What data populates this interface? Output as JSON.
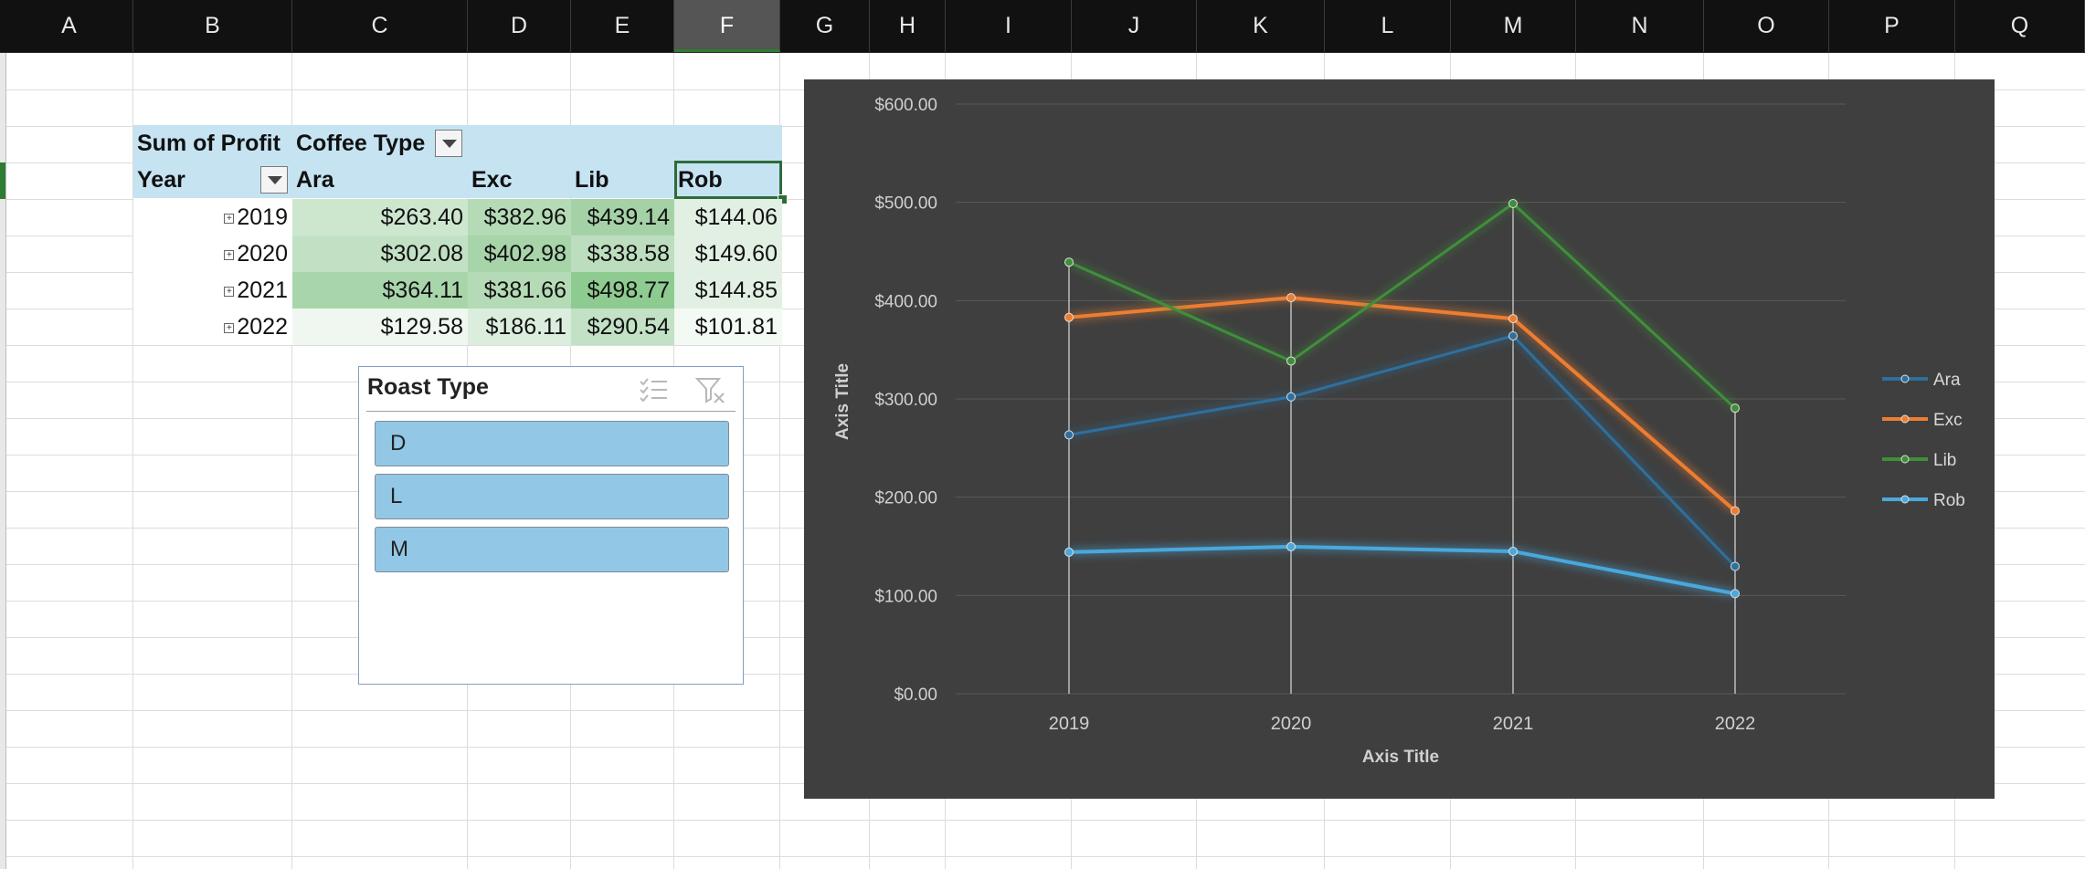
{
  "columns": [
    "A",
    "B",
    "C",
    "D",
    "E",
    "F",
    "G",
    "H",
    "I",
    "J",
    "K",
    "L",
    "M",
    "N",
    "O",
    "P",
    "Q"
  ],
  "active_column": "F",
  "pivot": {
    "corner_label": "Sum of Profit",
    "col_field_label": "Coffee Type",
    "row_field_label": "Year",
    "col_headers": [
      "Ara",
      "Exc",
      "Lib",
      "Rob"
    ],
    "rows": [
      {
        "year": "2019",
        "values": [
          "$263.40",
          "$382.96",
          "$439.14",
          "$144.06"
        ]
      },
      {
        "year": "2020",
        "values": [
          "$302.08",
          "$402.98",
          "$338.58",
          "$149.60"
        ]
      },
      {
        "year": "2021",
        "values": [
          "$364.11",
          "$381.66",
          "$498.77",
          "$144.85"
        ]
      },
      {
        "year": "2022",
        "values": [
          "$129.58",
          "$186.11",
          "$290.54",
          "$101.81"
        ]
      }
    ],
    "heat_colors": [
      [
        "#cde7cf",
        "#b4dbb6",
        "#a4d2a6",
        "#e2f0e3"
      ],
      [
        "#c2e1c4",
        "#a8d4aa",
        "#bcdebe",
        "#e2f0e3"
      ],
      [
        "#a9d5ab",
        "#b4dbb6",
        "#8ecb91",
        "#e2f0e3"
      ],
      [
        "#eff7f0",
        "#dbeddc",
        "#c3e1c5",
        "#f3f9f3"
      ]
    ]
  },
  "slicer": {
    "title": "Roast Type",
    "items": [
      "D",
      "L",
      "M"
    ],
    "multiselect_icon": "multi-select-icon",
    "clear_icon": "clear-filter-icon"
  },
  "chart_data": {
    "type": "line",
    "x": [
      "2019",
      "2020",
      "2021",
      "2022"
    ],
    "series": [
      {
        "name": "Ara",
        "values": [
          263.4,
          302.08,
          364.11,
          129.58
        ],
        "color": "#2e6f9e"
      },
      {
        "name": "Exc",
        "values": [
          382.96,
          402.98,
          381.66,
          186.11
        ],
        "color": "#ed7d31"
      },
      {
        "name": "Lib",
        "values": [
          439.14,
          338.58,
          498.77,
          290.54
        ],
        "color": "#3f8f3a"
      },
      {
        "name": "Rob",
        "values": [
          144.06,
          149.6,
          144.85,
          101.81
        ],
        "color": "#4aa8dc"
      }
    ],
    "y_ticks": [
      "$0.00",
      "$100.00",
      "$200.00",
      "$300.00",
      "$400.00",
      "$500.00",
      "$600.00"
    ],
    "ylim": [
      0,
      600
    ],
    "xlabel": "Axis Title",
    "ylabel": "Axis Title",
    "legend_position": "right",
    "grid": true,
    "drop_lines": true,
    "background": "#3f3f3f"
  }
}
